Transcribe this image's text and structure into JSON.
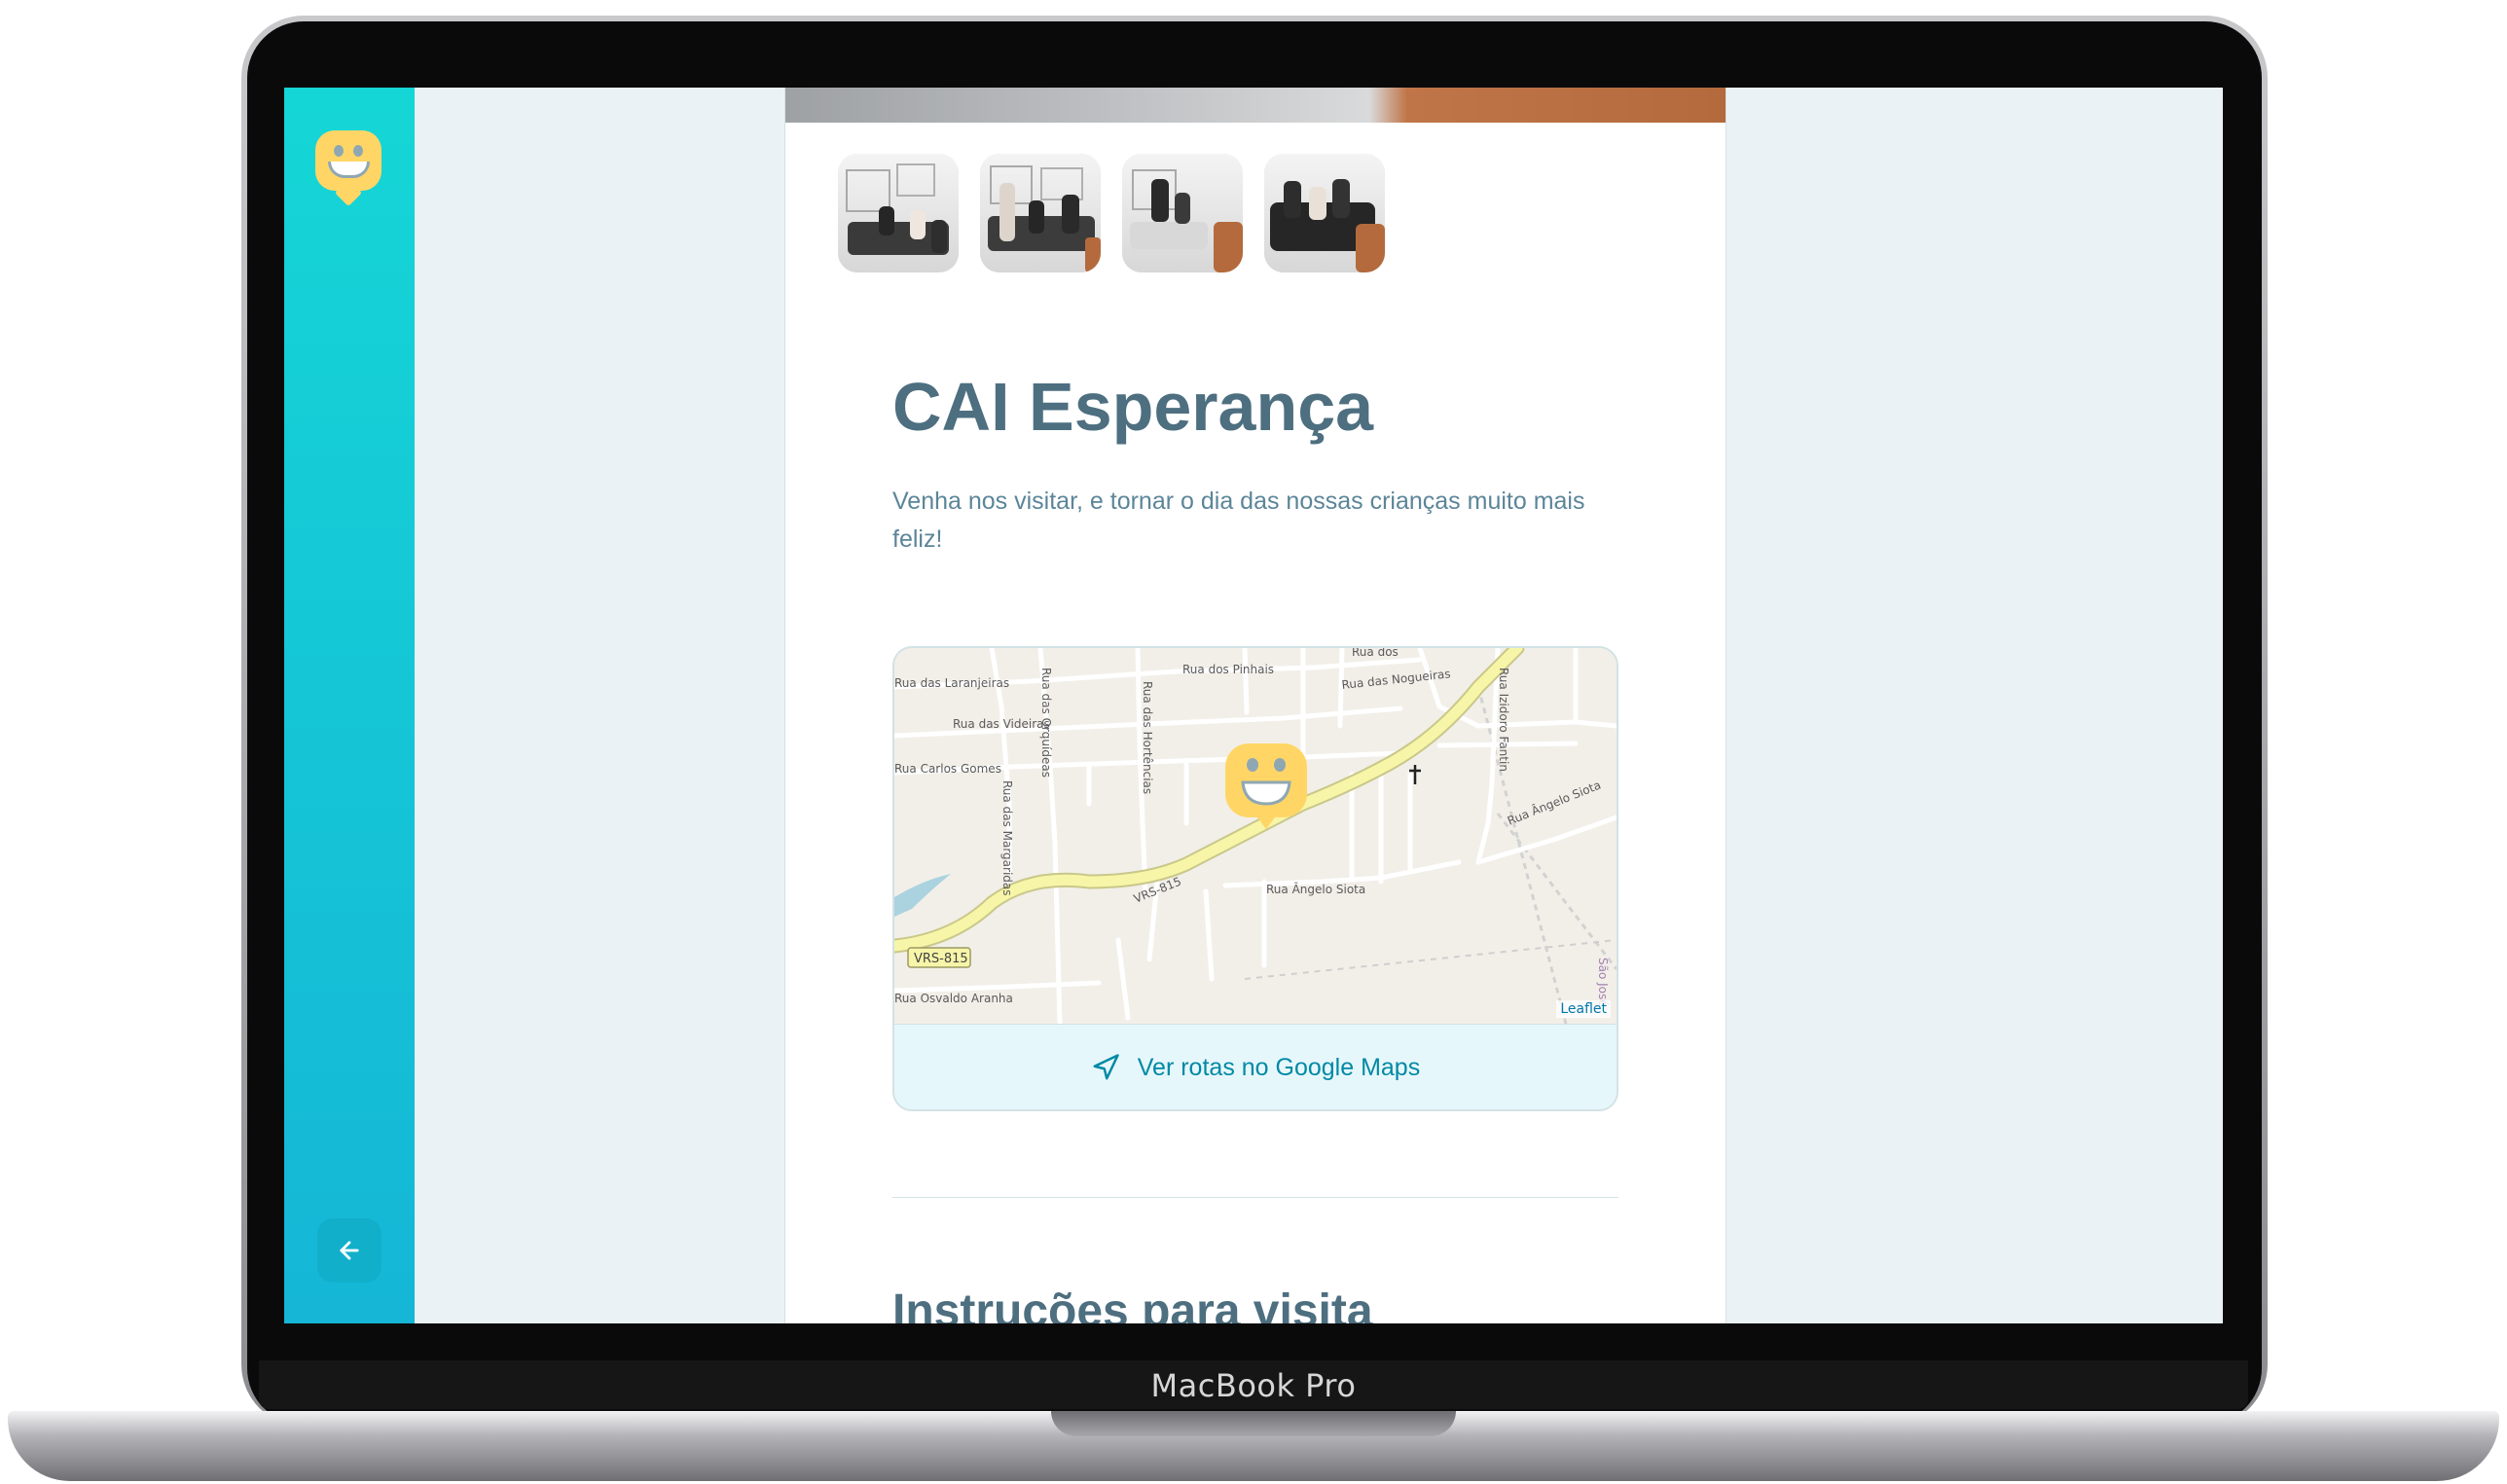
{
  "device": {
    "label": "MacBook Pro"
  },
  "orphanage": {
    "name": "CAI Esperança",
    "about": "Venha nos visitar, e tornar o dia das nossas crianças muito mais feliz!"
  },
  "gallery": {
    "thumbnails": [
      {
        "name": "photo-1"
      },
      {
        "name": "photo-2"
      },
      {
        "name": "photo-3"
      },
      {
        "name": "photo-4"
      }
    ]
  },
  "map": {
    "attribution": "Leaflet",
    "directions_label": "Ver rotas no Google Maps",
    "streets": [
      "Rua dos Pinhais",
      "Rua dos",
      "Rua das Nogueiras",
      "Rua das Laranjeiras",
      "Rua das Videiras",
      "Rua Carlos Gomes",
      "Rua das Orquídeas",
      "Rua das Hortências",
      "Rua das Margaridas",
      "Rua Izidoro Fantin",
      "Rua Ângelo Siota",
      "Rua Ângelo Siota",
      "VRS-815",
      "VRS-815",
      "Rua Osvaldo Aranha",
      "São José"
    ]
  },
  "sections": {
    "instructions_title": "Instruções para visita"
  },
  "colors": {
    "sidebar_top": "#15d6d6",
    "sidebar_bottom": "#15b6d6",
    "title": "#4d6f80",
    "text": "#5c8599",
    "accent": "#0089a5",
    "marker": "#ffd666"
  },
  "icons": {
    "logo": "happy-face-icon",
    "back": "arrow-left-icon",
    "directions": "navigation-icon"
  }
}
